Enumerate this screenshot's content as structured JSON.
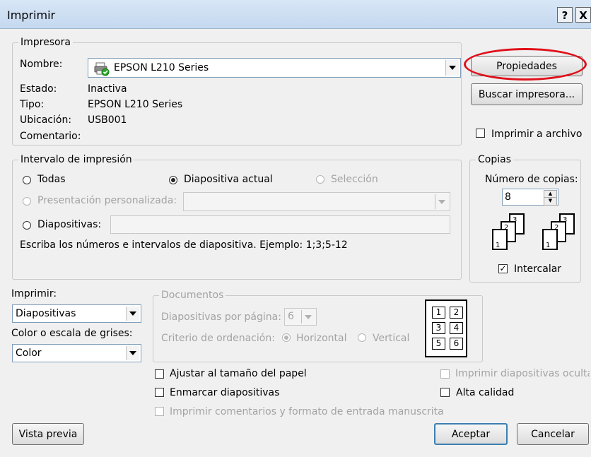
{
  "window": {
    "title": "Imprimir",
    "help": "?",
    "close": "X"
  },
  "printer": {
    "legend": "Impresora",
    "name_label": "Nombre:",
    "name_value": "EPSON L210 Series",
    "status_label": "Estado:",
    "status_value": "Inactiva",
    "type_label": "Tipo:",
    "type_value": "EPSON L210 Series",
    "location_label": "Ubicación:",
    "location_value": "USB001",
    "comment_label": "Comentario:",
    "properties_button": "Propiedades",
    "find_button": "Buscar impresora...",
    "print_to_file": "Imprimir a archivo",
    "highlight_color": "#e0101a"
  },
  "range": {
    "legend": "Intervalo de impresión",
    "all": "Todas",
    "current": "Diapositiva actual",
    "selection": "Selección",
    "custom": "Presentación personalizada:",
    "slides": "Diapositivas:",
    "hint": "Escriba los números e intervalos de diapositiva. Ejemplo: 1;3;5-12",
    "selected": "current"
  },
  "copies": {
    "legend": "Copias",
    "count_label": "Número de copias:",
    "count_value": "8",
    "collate": "Intercalar",
    "collate_checked": true,
    "pages": [
      "1",
      "2",
      "3"
    ]
  },
  "print_what": {
    "label": "Imprimir:",
    "value": "Diapositivas"
  },
  "color": {
    "label": "Color o escala de grises:",
    "value": "Color"
  },
  "handouts": {
    "legend": "Documentos",
    "per_page_label": "Diapositivas por página:",
    "per_page_value": "6",
    "order_label": "Criterio de ordenación:",
    "horizontal": "Horizontal",
    "vertical": "Vertical",
    "preview_numbers": [
      "1",
      "2",
      "3",
      "4",
      "5",
      "6"
    ]
  },
  "options": {
    "fit": "Ajustar al tamaño del papel",
    "frame": "Enmarcar diapositivas",
    "comments": "Imprimir comentarios y formato de entrada manuscrita",
    "hidden": "Imprimir diapositivas ocultas",
    "quality": "Alta calidad"
  },
  "footer": {
    "preview": "Vista previa",
    "ok": "Aceptar",
    "cancel": "Cancelar"
  }
}
